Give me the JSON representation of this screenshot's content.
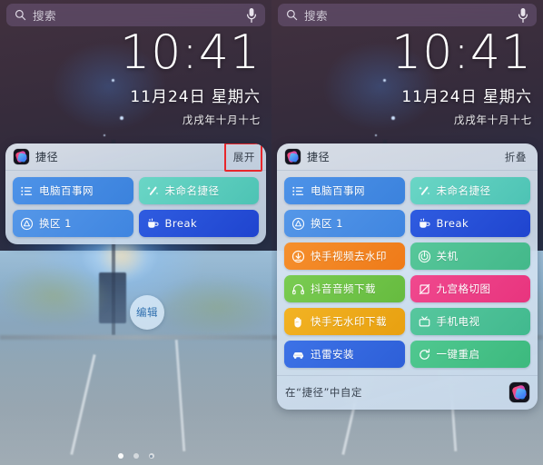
{
  "search": {
    "placeholder": "搜索",
    "icon": "search-icon",
    "mic_icon": "mic-icon"
  },
  "lockscreen": {
    "time": "10:41",
    "date": "11月24日 星期六",
    "lunar": "戊戌年十月十七"
  },
  "widget": {
    "app_name": "捷径",
    "app_icon": "shortcuts-app-icon",
    "expand_label": "展开",
    "collapse_label": "折叠",
    "footer_text": "在“捷径”中自定",
    "footer_icon": "shortcuts-app-icon"
  },
  "shortcuts_collapsed": [
    {
      "label": "电脑百事网",
      "icon": "list-bullet-icon",
      "color": "#3b82dd",
      "color2": "#4e93e8"
    },
    {
      "label": "未命名捷径",
      "icon": "magic-wand-icon",
      "color": "#4dc3b4",
      "color2": "#6ad6c6"
    },
    {
      "label": "换区 1",
      "icon": "playstation-triangle-icon",
      "color": "#3f85e0",
      "color2": "#5597e8"
    },
    {
      "label": "Break",
      "icon": "coffee-cup-icon",
      "color": "#1f44cf",
      "color2": "#2f5ce0"
    }
  ],
  "shortcuts_expanded": [
    {
      "label": "电脑百事网",
      "icon": "list-bullet-icon",
      "color": "#3b82dd",
      "color2": "#4e93e8"
    },
    {
      "label": "未命名捷径",
      "icon": "magic-wand-icon",
      "color": "#4dc3b4",
      "color2": "#6ad6c6"
    },
    {
      "label": "换区 1",
      "icon": "playstation-triangle-icon",
      "color": "#3f85e0",
      "color2": "#5597e8"
    },
    {
      "label": "Break",
      "icon": "coffee-cup-icon",
      "color": "#1f44cf",
      "color2": "#2f5ce0"
    },
    {
      "label": "快手视频去水印",
      "icon": "download-circle-icon",
      "color": "#ef7a18",
      "color2": "#f5902e"
    },
    {
      "label": "关机",
      "icon": "power-icon",
      "color": "#43b88a",
      "color2": "#57c79a"
    },
    {
      "label": "抖音音频下载",
      "icon": "headphones-icon",
      "color": "#66bb3f",
      "color2": "#7acc52"
    },
    {
      "label": "九宫格切图",
      "icon": "crop-icon",
      "color": "#e8347e",
      "color2": "#f0498e"
    },
    {
      "label": "快手无水印下载",
      "icon": "hand-raised-icon",
      "color": "#e8a010",
      "color2": "#f2b324"
    },
    {
      "label": "手机电视",
      "icon": "tv-icon",
      "color": "#41b98e",
      "color2": "#57c79e"
    },
    {
      "label": "迅雷安装",
      "icon": "car-icon",
      "color": "#2d5fd8",
      "color2": "#3d72e6"
    },
    {
      "label": "一键重启",
      "icon": "refresh-icon",
      "color": "#3cb97e",
      "color2": "#50c890"
    }
  ],
  "edit_button": {
    "label": "编辑"
  },
  "page_dots": [
    {
      "state": "active",
      "icon": "dot"
    },
    {
      "state": "inactive",
      "icon": "dot"
    },
    {
      "state": "inactive",
      "icon": "camera-dot"
    }
  ],
  "colors": {
    "annotation_red": "#e8262b",
    "widget_bg": "#e3ecf6",
    "accent_blue": "#2f6fae"
  }
}
